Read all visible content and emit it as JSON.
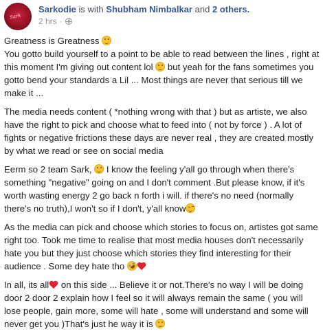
{
  "header": {
    "author": "Sarkodie",
    "with_text": "is with",
    "tagged": "Shubham Nimbalkar",
    "and_text": "and",
    "others": "2 others.",
    "time": "2 hrs",
    "separator": "·",
    "privacy_icon": "globe-icon",
    "avatar_signature": "Sark"
  },
  "post": {
    "p1": {
      "a": "Greatness is Greatness ",
      "b": "You gotto build yourself to a point to be able to read between the lines , right at this moment I'm giving out content lol ",
      "c": " but yeah for the fans sometimes you gotto bend your standards a Lil ... Most things are never that serious till we make it ..."
    },
    "p2": "The media needs content ( *nothing wrong with that ) but as artiste, we also have the right to pick and choose what to feed into ( not by force ) . A lot of fights or negative frictions these days are never real , they are created mostly by what we read or see on social media",
    "p3": {
      "a": "Eerm so 2 team Sark, ",
      "b": " I know the feeling y'all go through when there's something \"negative\" going on and I don't comment .But please know, if it's worth wasting energy 2 go back n forth i will. if there's no need (normally there's no truth),I won't so if I don't, y'all know"
    },
    "p4": "As the media can pick and choose which stories to focus on, artistes got same right too. Took me time to realise that most media houses don't necessarily hate you but they just choose which stories they find interesting for their audience . Some dey hate tho ",
    "p5": {
      "a": "In all, its all",
      "b": " on this side ... Believe it or not.There's no way I will be doing door 2 door 2 explain how I feel so it will always remain the same ( you will lose people, gain more, some will hate , some will understand and some will never get you )That's just he way it is "
    },
    "emojis": {
      "smile": "smiling-face-icon",
      "wink": "winking-face-icon",
      "rofl": "rolling-laughing-face-icon",
      "heart": "red-heart-icon"
    }
  }
}
